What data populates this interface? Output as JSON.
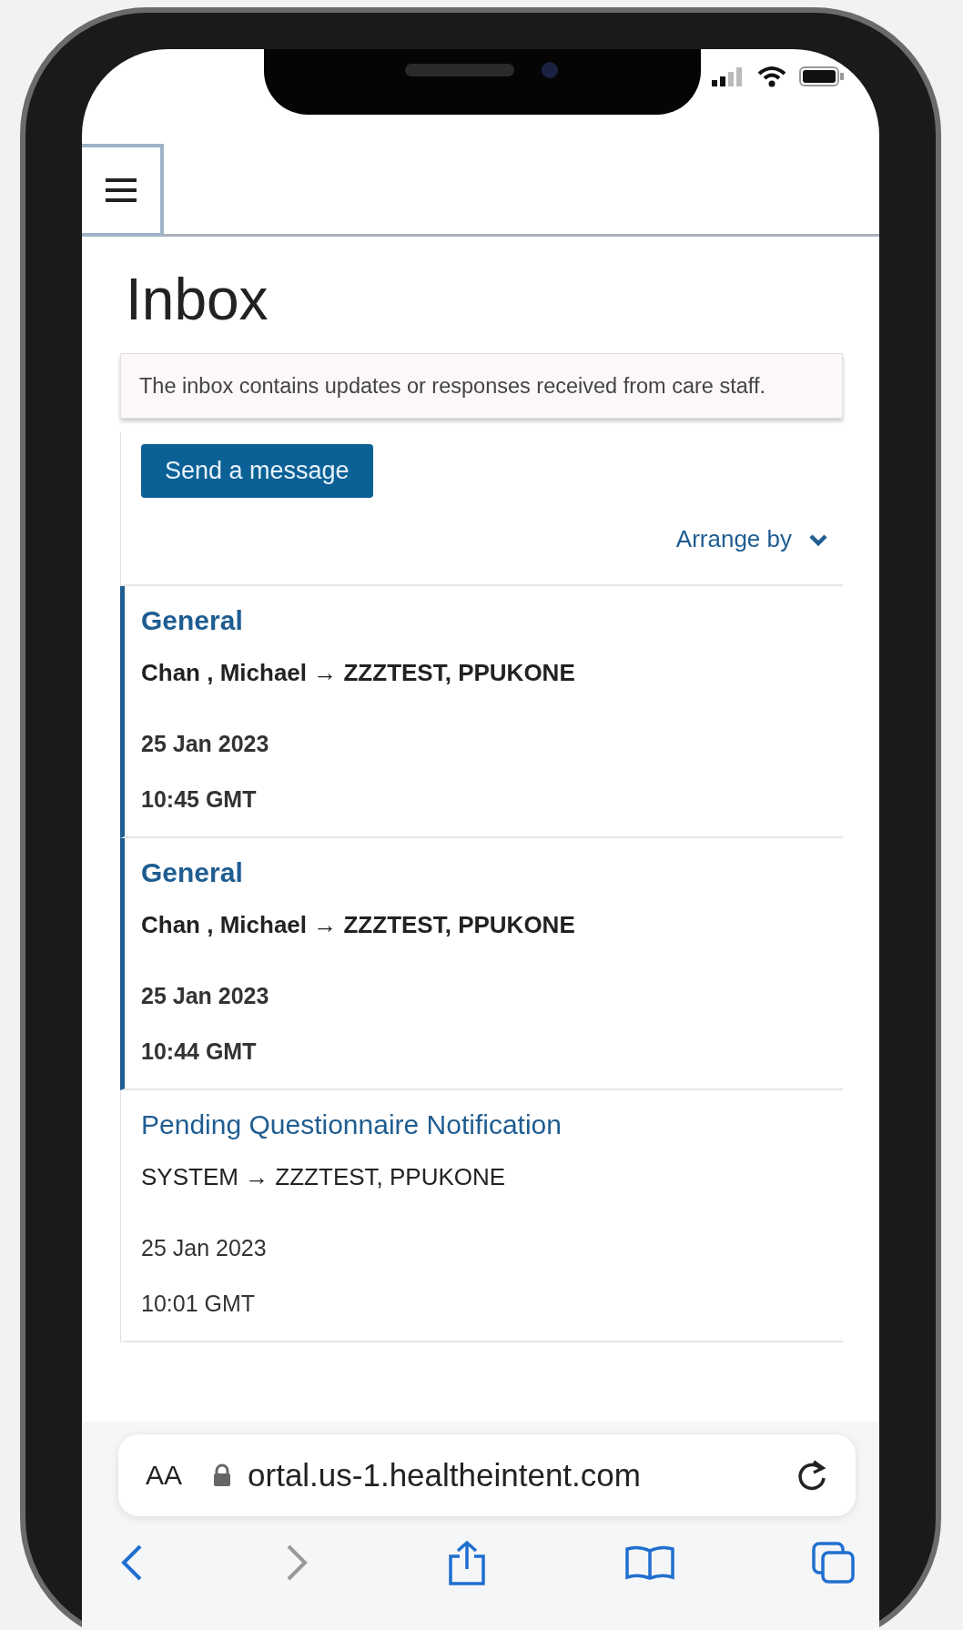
{
  "page": {
    "title": "Inbox",
    "notice": "The inbox contains updates or responses received from care staff."
  },
  "actions": {
    "send_button": "Send a message",
    "arrange_by": "Arrange by"
  },
  "messages": [
    {
      "category": "General",
      "route": "Chan , Michael → ZZZTEST, PPUKONE",
      "date": "25 Jan 2023",
      "time": "10:45 GMT",
      "unread": true
    },
    {
      "category": "General",
      "route": "Chan , Michael → ZZZTEST, PPUKONE",
      "date": "25 Jan 2023",
      "time": "10:44 GMT",
      "unread": true
    },
    {
      "category": "Pending Questionnaire Notification",
      "route": "SYSTEM → ZZZTEST, PPUKONE",
      "date": "25 Jan 2023",
      "time": "10:01 GMT",
      "unread": false
    }
  ],
  "browser": {
    "text_size": "AA",
    "url": "ortal.us-1.healtheintent.com"
  }
}
